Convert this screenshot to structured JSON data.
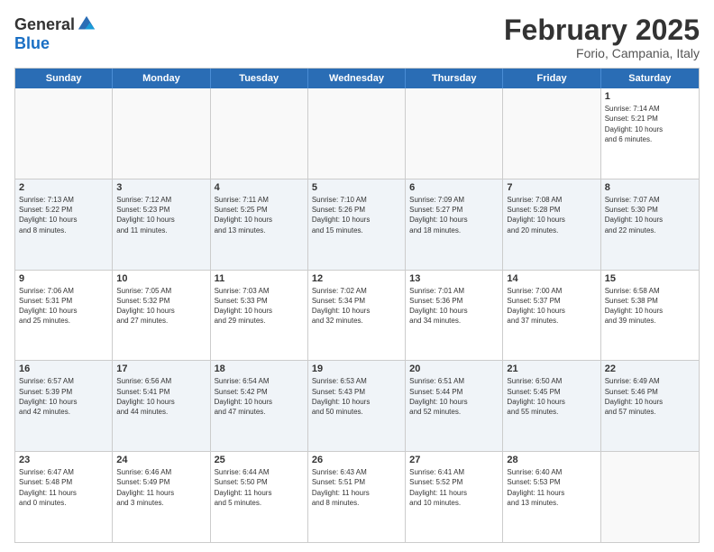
{
  "logo": {
    "general": "General",
    "blue": "Blue"
  },
  "title": "February 2025",
  "subtitle": "Forio, Campania, Italy",
  "days": [
    "Sunday",
    "Monday",
    "Tuesday",
    "Wednesday",
    "Thursday",
    "Friday",
    "Saturday"
  ],
  "weeks": [
    [
      {
        "day": "",
        "info": ""
      },
      {
        "day": "",
        "info": ""
      },
      {
        "day": "",
        "info": ""
      },
      {
        "day": "",
        "info": ""
      },
      {
        "day": "",
        "info": ""
      },
      {
        "day": "",
        "info": ""
      },
      {
        "day": "1",
        "info": "Sunrise: 7:14 AM\nSunset: 5:21 PM\nDaylight: 10 hours\nand 6 minutes."
      }
    ],
    [
      {
        "day": "2",
        "info": "Sunrise: 7:13 AM\nSunset: 5:22 PM\nDaylight: 10 hours\nand 8 minutes."
      },
      {
        "day": "3",
        "info": "Sunrise: 7:12 AM\nSunset: 5:23 PM\nDaylight: 10 hours\nand 11 minutes."
      },
      {
        "day": "4",
        "info": "Sunrise: 7:11 AM\nSunset: 5:25 PM\nDaylight: 10 hours\nand 13 minutes."
      },
      {
        "day": "5",
        "info": "Sunrise: 7:10 AM\nSunset: 5:26 PM\nDaylight: 10 hours\nand 15 minutes."
      },
      {
        "day": "6",
        "info": "Sunrise: 7:09 AM\nSunset: 5:27 PM\nDaylight: 10 hours\nand 18 minutes."
      },
      {
        "day": "7",
        "info": "Sunrise: 7:08 AM\nSunset: 5:28 PM\nDaylight: 10 hours\nand 20 minutes."
      },
      {
        "day": "8",
        "info": "Sunrise: 7:07 AM\nSunset: 5:30 PM\nDaylight: 10 hours\nand 22 minutes."
      }
    ],
    [
      {
        "day": "9",
        "info": "Sunrise: 7:06 AM\nSunset: 5:31 PM\nDaylight: 10 hours\nand 25 minutes."
      },
      {
        "day": "10",
        "info": "Sunrise: 7:05 AM\nSunset: 5:32 PM\nDaylight: 10 hours\nand 27 minutes."
      },
      {
        "day": "11",
        "info": "Sunrise: 7:03 AM\nSunset: 5:33 PM\nDaylight: 10 hours\nand 29 minutes."
      },
      {
        "day": "12",
        "info": "Sunrise: 7:02 AM\nSunset: 5:34 PM\nDaylight: 10 hours\nand 32 minutes."
      },
      {
        "day": "13",
        "info": "Sunrise: 7:01 AM\nSunset: 5:36 PM\nDaylight: 10 hours\nand 34 minutes."
      },
      {
        "day": "14",
        "info": "Sunrise: 7:00 AM\nSunset: 5:37 PM\nDaylight: 10 hours\nand 37 minutes."
      },
      {
        "day": "15",
        "info": "Sunrise: 6:58 AM\nSunset: 5:38 PM\nDaylight: 10 hours\nand 39 minutes."
      }
    ],
    [
      {
        "day": "16",
        "info": "Sunrise: 6:57 AM\nSunset: 5:39 PM\nDaylight: 10 hours\nand 42 minutes."
      },
      {
        "day": "17",
        "info": "Sunrise: 6:56 AM\nSunset: 5:41 PM\nDaylight: 10 hours\nand 44 minutes."
      },
      {
        "day": "18",
        "info": "Sunrise: 6:54 AM\nSunset: 5:42 PM\nDaylight: 10 hours\nand 47 minutes."
      },
      {
        "day": "19",
        "info": "Sunrise: 6:53 AM\nSunset: 5:43 PM\nDaylight: 10 hours\nand 50 minutes."
      },
      {
        "day": "20",
        "info": "Sunrise: 6:51 AM\nSunset: 5:44 PM\nDaylight: 10 hours\nand 52 minutes."
      },
      {
        "day": "21",
        "info": "Sunrise: 6:50 AM\nSunset: 5:45 PM\nDaylight: 10 hours\nand 55 minutes."
      },
      {
        "day": "22",
        "info": "Sunrise: 6:49 AM\nSunset: 5:46 PM\nDaylight: 10 hours\nand 57 minutes."
      }
    ],
    [
      {
        "day": "23",
        "info": "Sunrise: 6:47 AM\nSunset: 5:48 PM\nDaylight: 11 hours\nand 0 minutes."
      },
      {
        "day": "24",
        "info": "Sunrise: 6:46 AM\nSunset: 5:49 PM\nDaylight: 11 hours\nand 3 minutes."
      },
      {
        "day": "25",
        "info": "Sunrise: 6:44 AM\nSunset: 5:50 PM\nDaylight: 11 hours\nand 5 minutes."
      },
      {
        "day": "26",
        "info": "Sunrise: 6:43 AM\nSunset: 5:51 PM\nDaylight: 11 hours\nand 8 minutes."
      },
      {
        "day": "27",
        "info": "Sunrise: 6:41 AM\nSunset: 5:52 PM\nDaylight: 11 hours\nand 10 minutes."
      },
      {
        "day": "28",
        "info": "Sunrise: 6:40 AM\nSunset: 5:53 PM\nDaylight: 11 hours\nand 13 minutes."
      },
      {
        "day": "",
        "info": ""
      }
    ]
  ],
  "altRows": [
    1,
    3
  ]
}
